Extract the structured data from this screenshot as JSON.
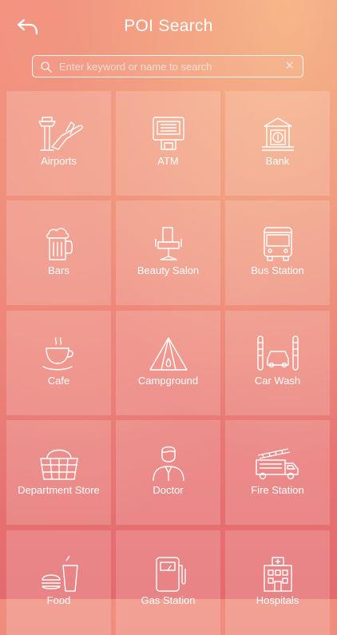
{
  "header": {
    "title": "POI Search"
  },
  "search": {
    "placeholder": "Enter keyword or name to search",
    "value": ""
  },
  "categories": [
    {
      "label": "Airports",
      "icon": "airport-icon"
    },
    {
      "label": "ATM",
      "icon": "atm-icon"
    },
    {
      "label": "Bank",
      "icon": "bank-icon"
    },
    {
      "label": "Bars",
      "icon": "beer-mug-icon"
    },
    {
      "label": "Beauty Salon",
      "icon": "salon-chair-icon"
    },
    {
      "label": "Bus Station",
      "icon": "bus-icon"
    },
    {
      "label": "Cafe",
      "icon": "coffee-cup-icon"
    },
    {
      "label": "Campground",
      "icon": "tent-icon"
    },
    {
      "label": "Car Wash",
      "icon": "car-wash-icon"
    },
    {
      "label": "Department Store",
      "icon": "shopping-basket-icon"
    },
    {
      "label": "Doctor",
      "icon": "doctor-icon"
    },
    {
      "label": "Fire Station",
      "icon": "fire-truck-icon"
    },
    {
      "label": "Food",
      "icon": "fast-food-icon"
    },
    {
      "label": "Gas Station",
      "icon": "fuel-pump-icon"
    },
    {
      "label": "Hospitals",
      "icon": "hospital-icon"
    }
  ]
}
